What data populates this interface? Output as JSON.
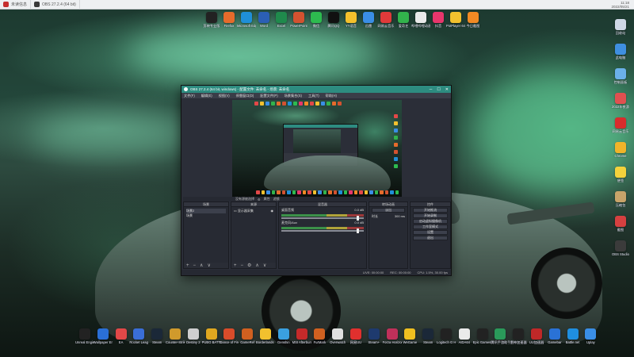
{
  "topbar": {
    "tabs": [
      {
        "label": "未读信息",
        "icon": "app-icon-red"
      },
      {
        "label": "OBS 27.2.4 (64 bit)",
        "icon": "obs-icon"
      }
    ],
    "clock_time": "11:18",
    "clock_date": "2022/05/21"
  },
  "desktop_top_icons": [
    {
      "label": "剪映专业版",
      "color": "#222222"
    },
    {
      "label": "Firefox",
      "color": "#e66b2b"
    },
    {
      "label": "Microsoft Edge",
      "color": "#1f8fd8"
    },
    {
      "label": "Word",
      "color": "#2b5fb4"
    },
    {
      "label": "Excel",
      "color": "#1f8a4c"
    },
    {
      "label": "PowerPoint",
      "color": "#d35230"
    },
    {
      "label": "微信",
      "color": "#2dbb4f"
    },
    {
      "label": "腾讯QQ",
      "color": "#111111"
    },
    {
      "label": "YY语音",
      "color": "#f3c02c"
    },
    {
      "label": "迅雷",
      "color": "#3a8ee6"
    },
    {
      "label": "网易云音乐",
      "color": "#e03a3a"
    },
    {
      "label": "爱奇艺",
      "color": "#32b34c"
    },
    {
      "label": "哔哩哔哩动画",
      "color": "#e9e9e9"
    },
    {
      "label": "抖音",
      "color": "#e8366c"
    },
    {
      "label": "PotPlayer 64 bit",
      "color": "#f2c12e"
    },
    {
      "label": "今日截图",
      "color": "#f08a24"
    }
  ],
  "desktop_right_icons": [
    {
      "label": "回收站",
      "color": "#cfd8e6"
    },
    {
      "label": "此电脑",
      "color": "#3f8fe0"
    },
    {
      "label": "控制面板",
      "color": "#6bb0e8"
    },
    {
      "label": "2022年夜游",
      "color": "#e05050"
    },
    {
      "label": "网易云音乐",
      "color": "#d92c2c"
    },
    {
      "label": "Chrome",
      "color": "#f0b429"
    },
    {
      "label": "便签",
      "color": "#f4d23c"
    },
    {
      "label": "压缩包",
      "color": "#c8a46a"
    },
    {
      "label": "截图",
      "color": "#d64040"
    },
    {
      "label": "OBS Studio",
      "color": "#3b3b3b"
    }
  ],
  "desktop_bottom_icons": [
    {
      "label": "Unreal Engine",
      "color": "#222222"
    },
    {
      "label": "Wallpaper Engine",
      "color": "#2a6fd6"
    },
    {
      "label": "EA",
      "color": "#e24848"
    },
    {
      "label": "Rocket League",
      "color": "#3a6ed8"
    },
    {
      "label": "Steam",
      "color": "#1b2838"
    },
    {
      "label": "Counter-Strike",
      "color": "#d09a2c"
    },
    {
      "label": "Destiny 2",
      "color": "#cfcfcf"
    },
    {
      "label": "PUBG BATTLEGROUNDS",
      "color": "#e0a820"
    },
    {
      "label": "Dance of Fire and Ice",
      "color": "#d94c2a"
    },
    {
      "label": "GameRef",
      "color": "#d06020"
    },
    {
      "label": "Borderlands 3",
      "color": "#f2c12e"
    },
    {
      "label": "Genshin",
      "color": "#3aa0e0"
    },
    {
      "label": "MSI Afterburner",
      "color": "#c42a2a"
    },
    {
      "label": "FurMark",
      "color": "#d06020"
    },
    {
      "label": "Overwatch",
      "color": "#e0e0e0"
    },
    {
      "label": "网易UU",
      "color": "#e0302e"
    },
    {
      "label": "Steam+",
      "color": "#1e3a6e"
    },
    {
      "label": "Forza Horizon 4",
      "color": "#c0305a"
    },
    {
      "label": "WeGame",
      "color": "#f0c020"
    },
    {
      "label": "Steam",
      "color": "#1b2838"
    },
    {
      "label": "Logitech G HUB",
      "color": "#222222"
    },
    {
      "label": "AIDA64",
      "color": "#eaeaea"
    },
    {
      "label": "Epic Games Launcher",
      "color": "#222222"
    },
    {
      "label": "腾讯手游助手",
      "color": "#2a9a5a"
    },
    {
      "label": "雷神加速器",
      "color": "#222222"
    },
    {
      "label": "UU加速器",
      "color": "#c02828"
    },
    {
      "label": "Gamebar",
      "color": "#2a72d6"
    },
    {
      "label": "Battle.net",
      "color": "#1f8fe0"
    },
    {
      "label": "Uplay",
      "color": "#3a8ee6"
    }
  ],
  "obs": {
    "title": "OBS 27.2.4 (64 bit, windows) - 配置文件: 未命名 - 场景: 未命名",
    "menu": [
      "文件(F)",
      "编辑(E)",
      "视图(V)",
      "停靠窗口(D)",
      "配置文件(P)",
      "场景集合(S)",
      "工具(T)",
      "帮助(H)"
    ],
    "subbar": [
      "没有源被选择",
      "属性",
      "滤镜"
    ],
    "docks": {
      "scenes": {
        "title": "场景",
        "items": [
          "场景2",
          "场景"
        ]
      },
      "sources": {
        "title": "来源",
        "items": [
          "显示器采集"
        ]
      },
      "mixer": {
        "title": "混音器",
        "channels": [
          {
            "name": "桌面音频",
            "db": "0.0 dB"
          },
          {
            "name": "麦克风/Aux",
            "db": "0.0 dB"
          }
        ]
      },
      "transitions": {
        "title": "转场动画",
        "type": "淡出",
        "duration_label": "时长",
        "duration": "300 ms"
      },
      "controls": {
        "title": "控件",
        "buttons": [
          "开始推流",
          "开始录制",
          "启动虚拟摄像机",
          "工作室模式",
          "设置",
          "退出"
        ]
      }
    },
    "status": {
      "live": "LIVE: 00:00:00",
      "rec": "REC: 00:00:00",
      "cpu": "CPU: 1.5%, 30.00 fps"
    }
  }
}
